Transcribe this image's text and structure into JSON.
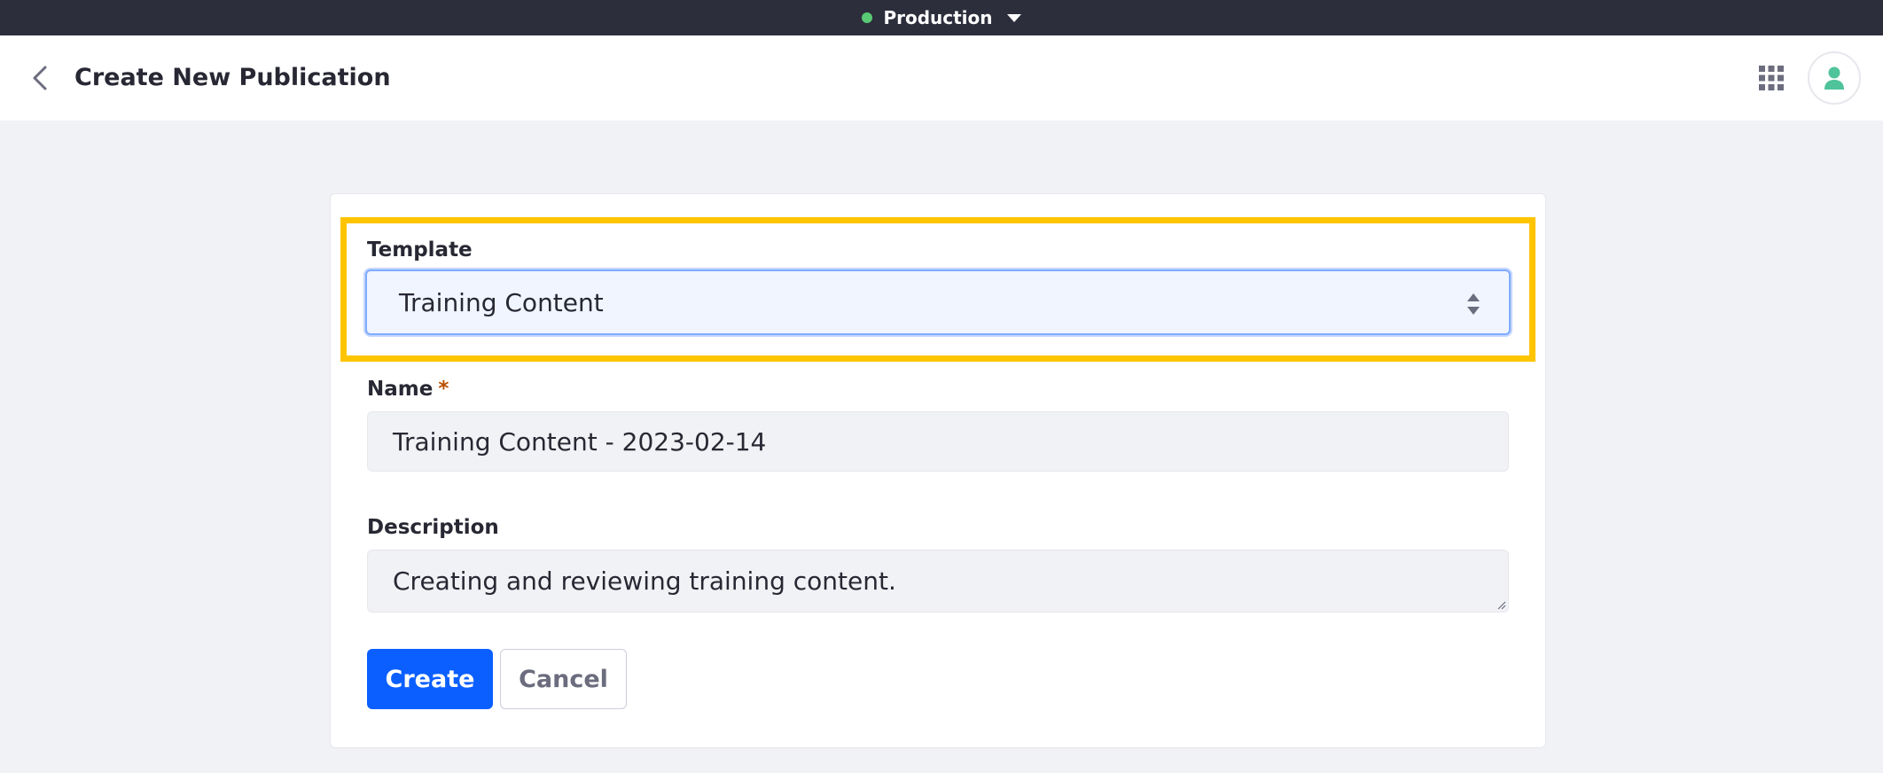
{
  "environment_bar": {
    "label": "Production",
    "status_color": "#5aca75"
  },
  "header": {
    "title": "Create New Publication",
    "icons": [
      "chevron-left-icon",
      "apps-grid-icon",
      "user-icon"
    ]
  },
  "form": {
    "template": {
      "label": "Template",
      "selected": "Training Content"
    },
    "name": {
      "label": "Name",
      "required_mark": "*",
      "value": "Training Content - 2023-02-14"
    },
    "description": {
      "label": "Description",
      "value": "Creating and reviewing training content."
    },
    "actions": {
      "create_label": "Create",
      "cancel_label": "Cancel"
    }
  },
  "colors": {
    "highlight": "#ffc400",
    "primary": "#0b5fff",
    "topbar": "#2c2e3c"
  }
}
